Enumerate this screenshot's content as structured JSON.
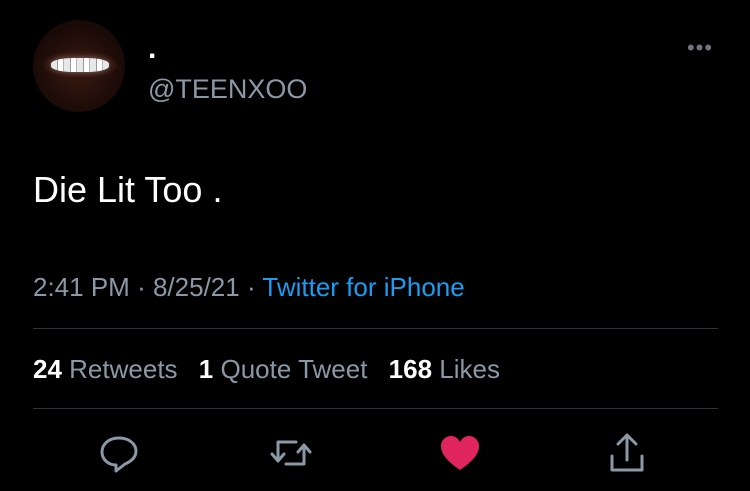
{
  "author": {
    "display_name": ".",
    "handle": "@TEENXOO",
    "avatar_icon": "avatar-lips-grillz"
  },
  "tweet": {
    "text": "Die Lit Too ."
  },
  "meta": {
    "time": "2:41 PM",
    "separator": "·",
    "date": "8/25/21",
    "source": "Twitter for iPhone"
  },
  "stats": {
    "retweets_count": "24",
    "retweets_label": "Retweets",
    "quote_count": "1",
    "quote_label": "Quote Tweet",
    "likes_count": "168",
    "likes_label": "Likes"
  },
  "actions": {
    "reply_icon": "reply-icon",
    "retweet_icon": "retweet-icon",
    "like_icon": "heart-icon",
    "share_icon": "share-icon"
  },
  "colors": {
    "background": "#000000",
    "text": "#ffffff",
    "secondary": "#8b98a5",
    "link": "#1d9bf0",
    "like": "#e0245e",
    "divider": "#2f3336"
  }
}
